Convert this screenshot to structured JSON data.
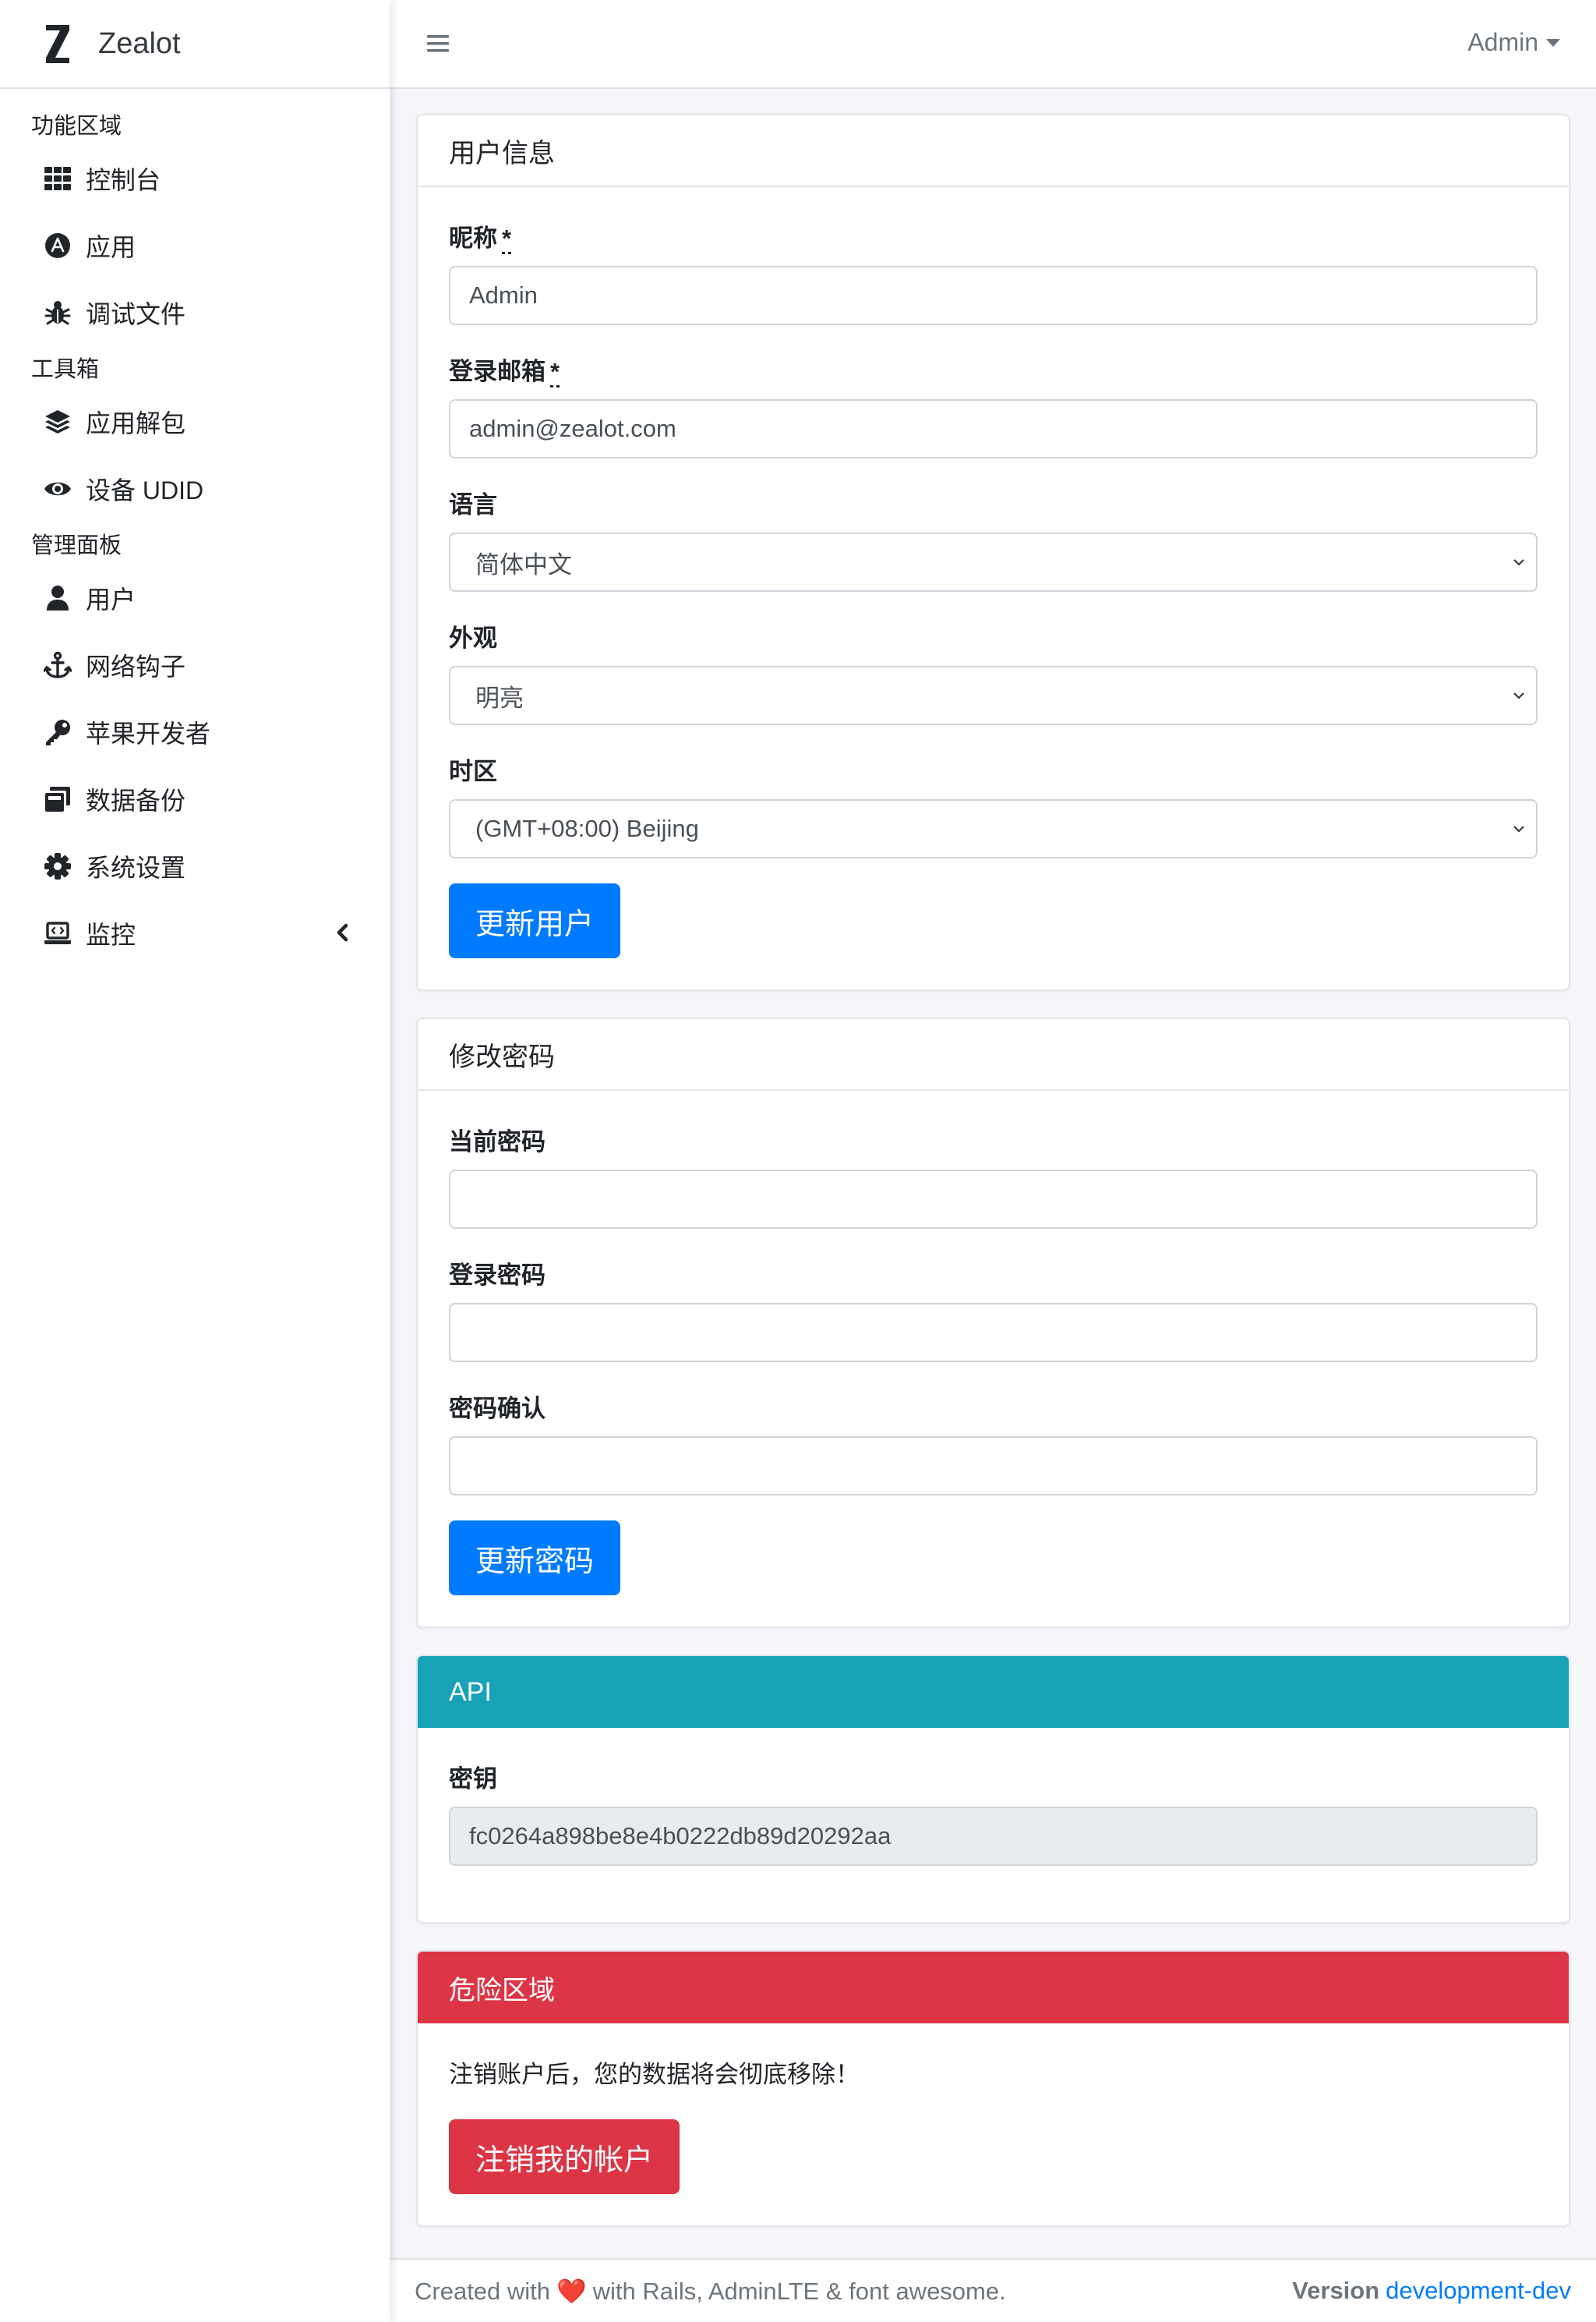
{
  "brand": {
    "name": "Zealot",
    "logo_letter": "Z"
  },
  "sidebar": {
    "sections": [
      {
        "header": "功能区域",
        "items": [
          {
            "label": "控制台",
            "icon": "th-icon"
          },
          {
            "label": "应用",
            "icon": "app-store-icon"
          },
          {
            "label": "调试文件",
            "icon": "bug-icon"
          }
        ]
      },
      {
        "header": "工具箱",
        "items": [
          {
            "label": "应用解包",
            "icon": "layers-icon"
          },
          {
            "label": "设备 UDID",
            "icon": "eye-icon"
          }
        ]
      },
      {
        "header": "管理面板",
        "items": [
          {
            "label": "用户",
            "icon": "user-icon"
          },
          {
            "label": "网络钩子",
            "icon": "anchor-icon"
          },
          {
            "label": "苹果开发者",
            "icon": "key-icon"
          },
          {
            "label": "数据备份",
            "icon": "copy-icon"
          },
          {
            "label": "系统设置",
            "icon": "gear-icon"
          },
          {
            "label": "监控",
            "icon": "laptop-code-icon"
          }
        ]
      }
    ]
  },
  "topbar": {
    "user": "Admin"
  },
  "user_info": {
    "title": "用户信息",
    "nickname_label": "昵称",
    "nickname_value": "Admin",
    "email_label": "登录邮箱",
    "email_value": "admin@zealot.com",
    "required_mark": "*",
    "language_label": "语言",
    "language_value": "简体中文",
    "appearance_label": "外观",
    "appearance_value": "明亮",
    "timezone_label": "时区",
    "timezone_value": "(GMT+08:00) Beijing",
    "submit": "更新用户"
  },
  "password": {
    "title": "修改密码",
    "current_label": "当前密码",
    "new_label": "登录密码",
    "confirm_label": "密码确认",
    "submit": "更新密码"
  },
  "api": {
    "title": "API",
    "key_label": "密钥",
    "key_value": "fc0264a898be8e4b0222db89d20292aa"
  },
  "danger": {
    "title": "危险区域",
    "text": "注销账户后，您的数据将会彻底移除！",
    "submit": "注销我的帐户"
  },
  "footer": {
    "created_prefix": "Created with",
    "heart": "❤️",
    "created_suffix": "with Rails, AdminLTE & font awesome.",
    "version_label": "Version",
    "version_value": "development-dev"
  },
  "colors": {
    "primary": "#007bff",
    "info": "#17a2b8",
    "danger": "#dc3545"
  }
}
